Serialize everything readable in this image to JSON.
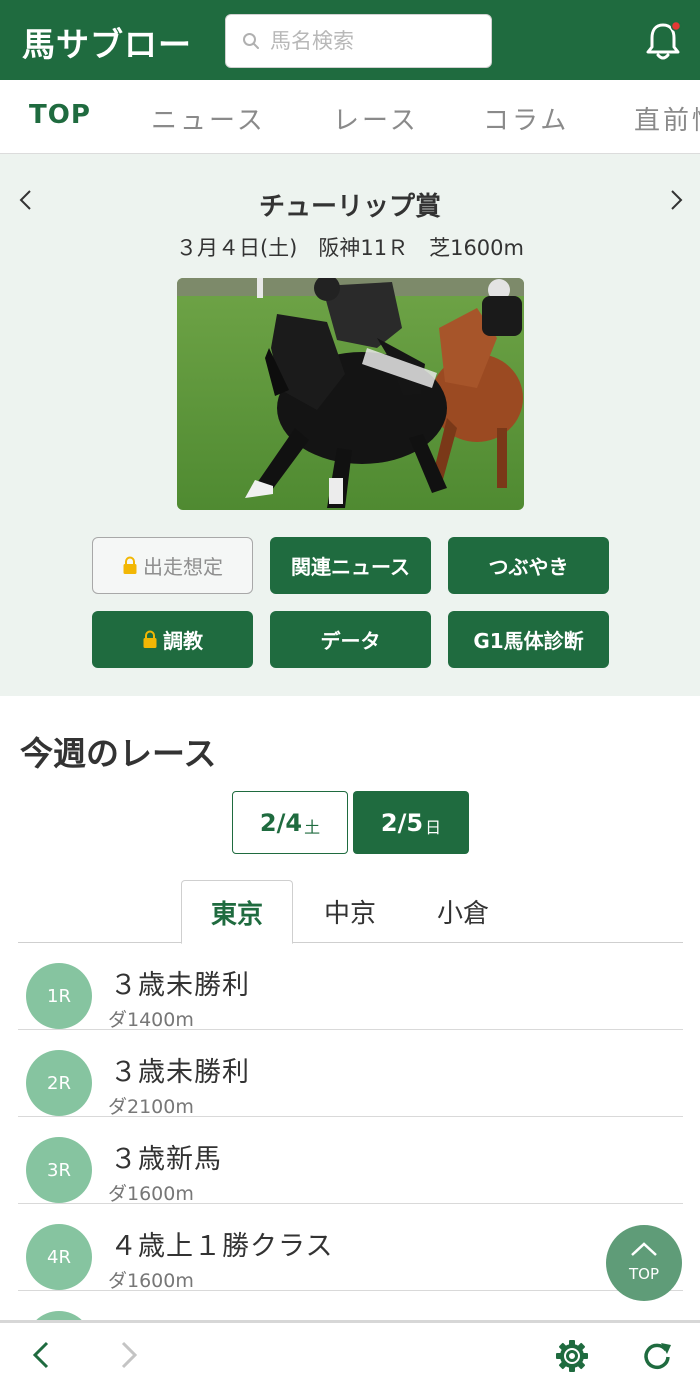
{
  "header": {
    "logo": "馬サブロー",
    "search_placeholder": "馬名検索"
  },
  "nav": {
    "tabs": [
      "TOP",
      "ニュース",
      "レース",
      "コラム",
      "直前情報"
    ],
    "active": "TOP"
  },
  "featured": {
    "title": "チューリップ賞",
    "info": "３月４日(土)　阪神11Ｒ　芝1600m",
    "buttons": [
      {
        "label": "出走想定",
        "locked": true,
        "enabled": false
      },
      {
        "label": "関連ニュース",
        "locked": false,
        "enabled": true
      },
      {
        "label": "つぶやき",
        "locked": false,
        "enabled": true
      },
      {
        "label": "調教",
        "locked": true,
        "enabled": true
      },
      {
        "label": "データ",
        "locked": false,
        "enabled": true
      },
      {
        "label": "G1馬体診断",
        "locked": false,
        "enabled": true
      }
    ]
  },
  "this_week": {
    "title": "今週のレース",
    "dates": [
      {
        "date": "2/4",
        "dow": "土",
        "selected": false
      },
      {
        "date": "2/5",
        "dow": "日",
        "selected": true
      }
    ],
    "venues": [
      "東京",
      "中京",
      "小倉"
    ],
    "active_venue": "東京",
    "races": [
      {
        "num": "1R",
        "name": "３歳未勝利",
        "dist": "ダ1400m"
      },
      {
        "num": "2R",
        "name": "３歳未勝利",
        "dist": "ダ2100m"
      },
      {
        "num": "3R",
        "name": "３歳新馬",
        "dist": "ダ1600m"
      },
      {
        "num": "4R",
        "name": "４歳上１勝クラス",
        "dist": "ダ1600m"
      }
    ]
  },
  "top_button": "TOP",
  "colors": {
    "brand": "#1f6b3f",
    "race_circle": "#86c4a0",
    "featured_bg": "#edf3ef",
    "notification_dot": "#e53935"
  }
}
